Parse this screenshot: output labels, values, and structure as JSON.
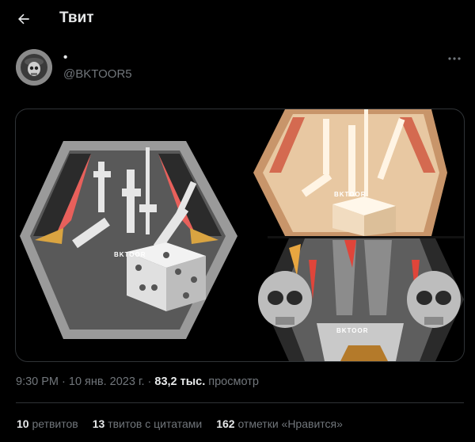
{
  "header": {
    "title": "Твит"
  },
  "author": {
    "display_name": "•",
    "handle": "@BKTOOR5"
  },
  "media": {
    "watermark": "BKTOOR"
  },
  "tweet_meta": {
    "time": "9:30 PM",
    "sep1": " · ",
    "date": "10 янв. 2023 г.",
    "sep2": " · ",
    "views_count": "83,2 тыс.",
    "views_label": " просмотр"
  },
  "stats": {
    "retweets_count": "10",
    "retweets_label": "ретвитов",
    "quotes_count": "13",
    "quotes_label": "твитов с цитатами",
    "likes_count": "162",
    "likes_label": "отметки «Нравится»"
  },
  "icons": {
    "back": "arrow-left-icon",
    "more": "more-horizontal-icon"
  },
  "colors": {
    "background": "#000000",
    "text": "#e7e9ea",
    "muted": "#71767b",
    "border": "#2f3336"
  }
}
